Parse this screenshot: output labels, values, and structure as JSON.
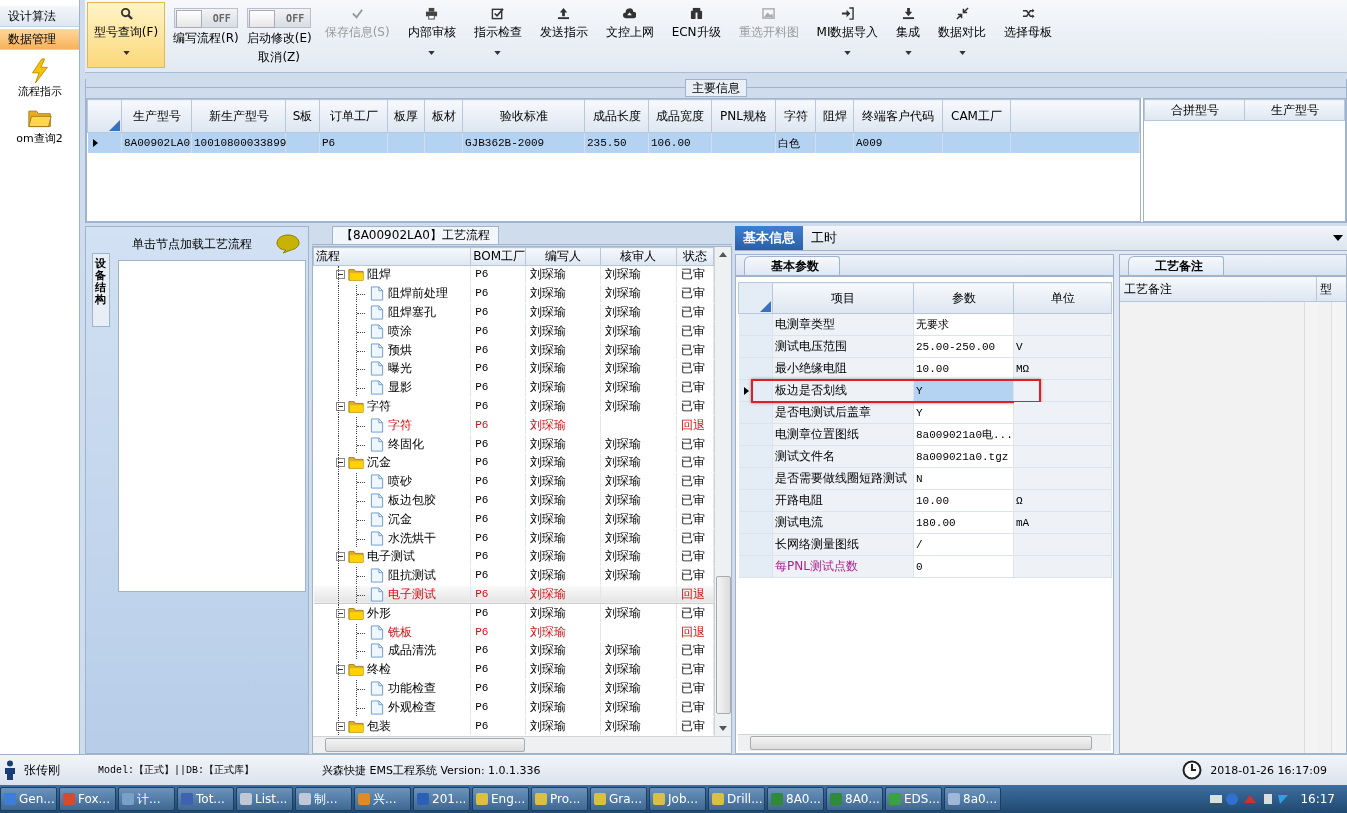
{
  "nav": {
    "items": [
      {
        "label": "设计算法",
        "selected": false
      },
      {
        "label": "数据管理",
        "selected": true
      }
    ],
    "shortcuts": [
      {
        "kind": "bolt",
        "label": "流程指示"
      },
      {
        "kind": "folder",
        "label": "om查询2"
      }
    ]
  },
  "toolbar": [
    {
      "kind": "search",
      "label": "型号查询(F)",
      "selected": true,
      "disabled": false,
      "dropdown": true
    },
    {
      "kind": "toggle",
      "label": "编写流程(R)",
      "toggle_text": "OFF",
      "on": false
    },
    {
      "kind": "toggle",
      "label": "启动修改(E)",
      "sublabel": "取消(Z)",
      "toggle_text": "OFF",
      "on": false
    },
    {
      "kind": "check",
      "label": "保存信息(S)",
      "selected": false,
      "disabled": true,
      "dropdown": false
    },
    {
      "kind": "printer",
      "label": "内部审核",
      "selected": false,
      "disabled": false,
      "dropdown": true
    },
    {
      "kind": "checkbox",
      "label": "指示检查",
      "selected": false,
      "disabled": false,
      "dropdown": true
    },
    {
      "kind": "upload",
      "label": "发送指示",
      "selected": false,
      "disabled": false,
      "dropdown": false
    },
    {
      "kind": "cloud",
      "label": "文控上网",
      "selected": false,
      "disabled": false,
      "dropdown": false
    },
    {
      "kind": "binoculars",
      "label": "ECN升级",
      "selected": false,
      "disabled": false,
      "dropdown": false
    },
    {
      "kind": "image",
      "label": "重选开料图",
      "selected": false,
      "disabled": true,
      "dropdown": false
    },
    {
      "kind": "import",
      "label": "MI数据导入",
      "selected": false,
      "disabled": false,
      "dropdown": true
    },
    {
      "kind": "download",
      "label": "集成",
      "selected": false,
      "disabled": false,
      "dropdown": true
    },
    {
      "kind": "compress",
      "label": "数据对比",
      "selected": false,
      "disabled": false,
      "dropdown": true
    },
    {
      "kind": "shuffle",
      "label": "选择母板",
      "selected": false,
      "disabled": false,
      "dropdown": false
    }
  ],
  "main_info": {
    "title": "主要信息",
    "columns": [
      "生产型号",
      "新生产型号",
      "S板",
      "订单工厂",
      "板厚",
      "板材",
      "验收标准",
      "成品长度",
      "成品宽度",
      "PNL规格",
      "字符",
      "阻焊",
      "终端客户代码",
      "CAM工厂"
    ],
    "rows": [
      {
        "selected": true,
        "cells": [
          "8A00902LA0",
          "10010800033899",
          null,
          "P6",
          null,
          null,
          "GJB362B-2009",
          "235.50",
          "106.00",
          null,
          "白色",
          null,
          "A009",
          null
        ]
      }
    ],
    "merge_columns": [
      "合拼型号",
      "生产型号"
    ]
  },
  "equipment": {
    "tab": "设备结构",
    "hint": "单击节点加载工艺流程"
  },
  "flow": {
    "title": "【8A00902LA0】工艺流程",
    "columns": [
      "流程",
      "BOM工厂",
      "编写人",
      "核审人",
      "状态"
    ],
    "nodes": [
      {
        "label": "阻焊",
        "bom": "P6",
        "writer": "刘琛瑜",
        "reviewer": "刘琛瑜",
        "status": "已审",
        "returned": false,
        "selected": false,
        "expanded": true,
        "children": [
          {
            "label": "阻焊前处理",
            "bom": "P6",
            "writer": "刘琛瑜",
            "reviewer": "刘琛瑜",
            "status": "已审",
            "returned": false,
            "selected": false
          },
          {
            "label": "阻焊塞孔",
            "bom": "P6",
            "writer": "刘琛瑜",
            "reviewer": "刘琛瑜",
            "status": "已审",
            "returned": false,
            "selected": false
          },
          {
            "label": "喷涂",
            "bom": "P6",
            "writer": "刘琛瑜",
            "reviewer": "刘琛瑜",
            "status": "已审",
            "returned": false,
            "selected": false
          },
          {
            "label": "预烘",
            "bom": "P6",
            "writer": "刘琛瑜",
            "reviewer": "刘琛瑜",
            "status": "已审",
            "returned": false,
            "selected": false
          },
          {
            "label": "曝光",
            "bom": "P6",
            "writer": "刘琛瑜",
            "reviewer": "刘琛瑜",
            "status": "已审",
            "returned": false,
            "selected": false
          },
          {
            "label": "显影",
            "bom": "P6",
            "writer": "刘琛瑜",
            "reviewer": "刘琛瑜",
            "status": "已审",
            "returned": false,
            "selected": false
          }
        ]
      },
      {
        "label": "字符",
        "bom": "P6",
        "writer": "刘琛瑜",
        "reviewer": "刘琛瑜",
        "status": "已审",
        "returned": false,
        "selected": false,
        "expanded": true,
        "children": [
          {
            "label": "字符",
            "bom": "P6",
            "writer": "刘琛瑜",
            "status": "回退",
            "returned": true,
            "selected": false
          },
          {
            "label": "终固化",
            "bom": "P6",
            "writer": "刘琛瑜",
            "reviewer": "刘琛瑜",
            "status": "已审",
            "returned": false,
            "selected": false
          }
        ]
      },
      {
        "label": "沉金",
        "bom": "P6",
        "writer": "刘琛瑜",
        "reviewer": "刘琛瑜",
        "status": "已审",
        "returned": false,
        "selected": false,
        "expanded": true,
        "children": [
          {
            "label": "喷砂",
            "bom": "P6",
            "writer": "刘琛瑜",
            "reviewer": "刘琛瑜",
            "status": "已审",
            "returned": false,
            "selected": false
          },
          {
            "label": "板边包胶",
            "bom": "P6",
            "writer": "刘琛瑜",
            "reviewer": "刘琛瑜",
            "status": "已审",
            "returned": false,
            "selected": false
          },
          {
            "label": "沉金",
            "bom": "P6",
            "writer": "刘琛瑜",
            "reviewer": "刘琛瑜",
            "status": "已审",
            "returned": false,
            "selected": false
          },
          {
            "label": "水洗烘干",
            "bom": "P6",
            "writer": "刘琛瑜",
            "reviewer": "刘琛瑜",
            "status": "已审",
            "returned": false,
            "selected": false
          }
        ]
      },
      {
        "label": "电子测试",
        "bom": "P6",
        "writer": "刘琛瑜",
        "reviewer": "刘琛瑜",
        "status": "已审",
        "returned": false,
        "selected": false,
        "expanded": true,
        "children": [
          {
            "label": "阻抗测试",
            "bom": "P6",
            "writer": "刘琛瑜",
            "reviewer": "刘琛瑜",
            "status": "已审",
            "returned": false,
            "selected": false
          },
          {
            "label": "电子测试",
            "bom": "P6",
            "writer": "刘琛瑜",
            "status": "回退",
            "returned": true,
            "selected": true
          }
        ]
      },
      {
        "label": "外形",
        "bom": "P6",
        "writer": "刘琛瑜",
        "reviewer": "刘琛瑜",
        "status": "已审",
        "returned": false,
        "selected": false,
        "expanded": true,
        "children": [
          {
            "label": "铣板",
            "bom": "P6",
            "writer": "刘琛瑜",
            "status": "回退",
            "returned": true,
            "selected": false
          },
          {
            "label": "成品清洗",
            "bom": "P6",
            "writer": "刘琛瑜",
            "reviewer": "刘琛瑜",
            "status": "已审",
            "returned": false,
            "selected": false
          }
        ]
      },
      {
        "label": "终检",
        "bom": "P6",
        "writer": "刘琛瑜",
        "reviewer": "刘琛瑜",
        "status": "已审",
        "returned": false,
        "selected": false,
        "expanded": true,
        "children": [
          {
            "label": "功能检查",
            "bom": "P6",
            "writer": "刘琛瑜",
            "reviewer": "刘琛瑜",
            "status": "已审",
            "returned": false,
            "selected": false
          },
          {
            "label": "外观检查",
            "bom": "P6",
            "writer": "刘琛瑜",
            "reviewer": "刘琛瑜",
            "status": "已审",
            "returned": false,
            "selected": false
          }
        ]
      },
      {
        "label": "包装",
        "bom": "P6",
        "writer": "刘琛瑜",
        "reviewer": "刘琛瑜",
        "status": "已审",
        "returned": false,
        "selected": false,
        "expanded": true
      }
    ]
  },
  "detail": {
    "tabs": [
      {
        "label": "基本信息",
        "selected": true
      },
      {
        "label": "工时",
        "selected": false
      }
    ],
    "params": {
      "tab": "基本参数",
      "columns": [
        "项目",
        "参数",
        "单位"
      ],
      "rows": [
        {
          "item": "电测章类型",
          "value": "无要求",
          "unit": null,
          "selected": false,
          "marked": false,
          "emphasis": false
        },
        {
          "item": "测试电压范围",
          "value": "25.00-250.00",
          "unit": "V",
          "selected": false,
          "marked": false,
          "emphasis": false
        },
        {
          "item": "最小绝缘电阻",
          "value": "10.00",
          "unit": "MΩ",
          "selected": false,
          "marked": false,
          "emphasis": false
        },
        {
          "item": "板边是否划线",
          "value": "Y",
          "unit": null,
          "selected": true,
          "marked": true,
          "emphasis": false
        },
        {
          "item": "是否电测试后盖章",
          "value": "Y",
          "unit": null,
          "selected": false,
          "marked": false,
          "emphasis": false
        },
        {
          "item": "电测章位置图纸",
          "value": "8a009021a0电...",
          "unit": null,
          "selected": false,
          "marked": false,
          "emphasis": false
        },
        {
          "item": "测试文件名",
          "value": "8a009021a0.tgz",
          "unit": null,
          "selected": false,
          "marked": false,
          "emphasis": false
        },
        {
          "item": "是否需要做线圈短路测试",
          "value": "N",
          "unit": null,
          "selected": false,
          "marked": false,
          "emphasis": false
        },
        {
          "item": "开路电阻",
          "value": "10.00",
          "unit": "Ω",
          "selected": false,
          "marked": false,
          "emphasis": false
        },
        {
          "item": "测试电流",
          "value": "180.00",
          "unit": "mA",
          "selected": false,
          "marked": false,
          "emphasis": false
        },
        {
          "item": "长网络测量图纸",
          "value": "/",
          "unit": null,
          "selected": false,
          "marked": false,
          "emphasis": false
        },
        {
          "item": "每PNL测试点数",
          "value": "0",
          "unit": null,
          "selected": false,
          "marked": false,
          "emphasis": true
        }
      ]
    },
    "notes": {
      "tab": "工艺备注",
      "columns": [
        "工艺备注",
        "型"
      ]
    }
  },
  "status_bar": {
    "user": "张传刚",
    "model": "Model:【正式】||DB:【正式库】",
    "system": "兴森快捷 EMS工程系统 Version: 1.0.1.336",
    "datetime": "2018-01-26 16:17:09"
  },
  "taskbar": {
    "items": [
      {
        "kind": "app",
        "label": "Gen..."
      },
      {
        "kind": "fox",
        "label": "Fox..."
      },
      {
        "kind": "calc",
        "label": "计..."
      },
      {
        "kind": "disk",
        "label": "Tot..."
      },
      {
        "kind": "doc",
        "label": "List..."
      },
      {
        "kind": "doc",
        "label": "制..."
      },
      {
        "kind": "star",
        "label": "兴..."
      },
      {
        "kind": "word",
        "label": "201..."
      },
      {
        "kind": "report",
        "label": "Eng..."
      },
      {
        "kind": "report",
        "label": "Pro..."
      },
      {
        "kind": "report",
        "label": "Gra..."
      },
      {
        "kind": "report",
        "label": "Job..."
      },
      {
        "kind": "report",
        "label": "Drill..."
      },
      {
        "kind": "excel",
        "label": "8A0..."
      },
      {
        "kind": "excel",
        "label": "8A0..."
      },
      {
        "kind": "eds",
        "label": "EDS..."
      },
      {
        "kind": "note",
        "label": "8a0..."
      }
    ],
    "clock": "16:17"
  }
}
